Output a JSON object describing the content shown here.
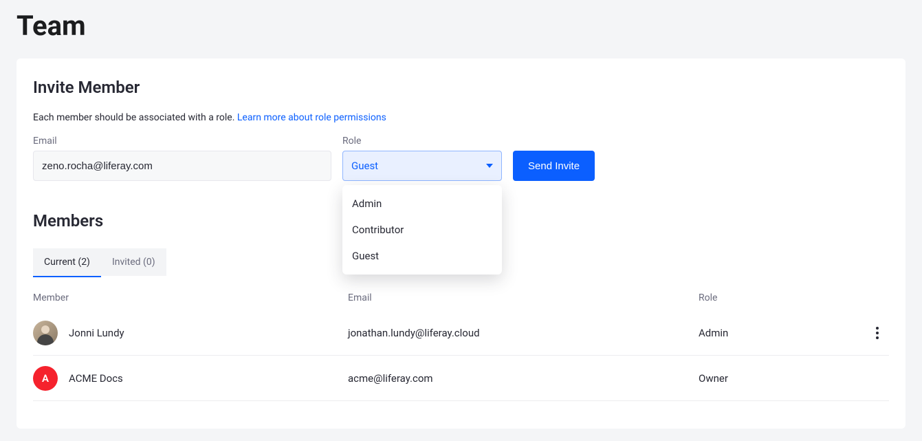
{
  "page": {
    "title": "Team"
  },
  "invite": {
    "title": "Invite Member",
    "helper_text": "Each member should be associated with a role. ",
    "helper_link": "Learn more about role permissions",
    "email_label": "Email",
    "email_value": "zeno.rocha@liferay.com",
    "role_label": "Role",
    "role_selected": "Guest",
    "role_options": [
      "Admin",
      "Contributor",
      "Guest"
    ],
    "submit_label": "Send Invite"
  },
  "members": {
    "title": "Members",
    "tabs": [
      {
        "label": "Current (2)",
        "active": true
      },
      {
        "label": "Invited (0)",
        "active": false
      }
    ],
    "columns": {
      "member": "Member",
      "email": "Email",
      "role": "Role"
    },
    "rows": [
      {
        "name": "Jonni Lundy",
        "email": "jonathan.lundy@liferay.cloud",
        "role": "Admin",
        "avatar_type": "photo",
        "avatar_initial": ""
      },
      {
        "name": "ACME Docs",
        "email": "acme@liferay.com",
        "role": "Owner",
        "avatar_type": "red",
        "avatar_initial": "A"
      }
    ]
  }
}
